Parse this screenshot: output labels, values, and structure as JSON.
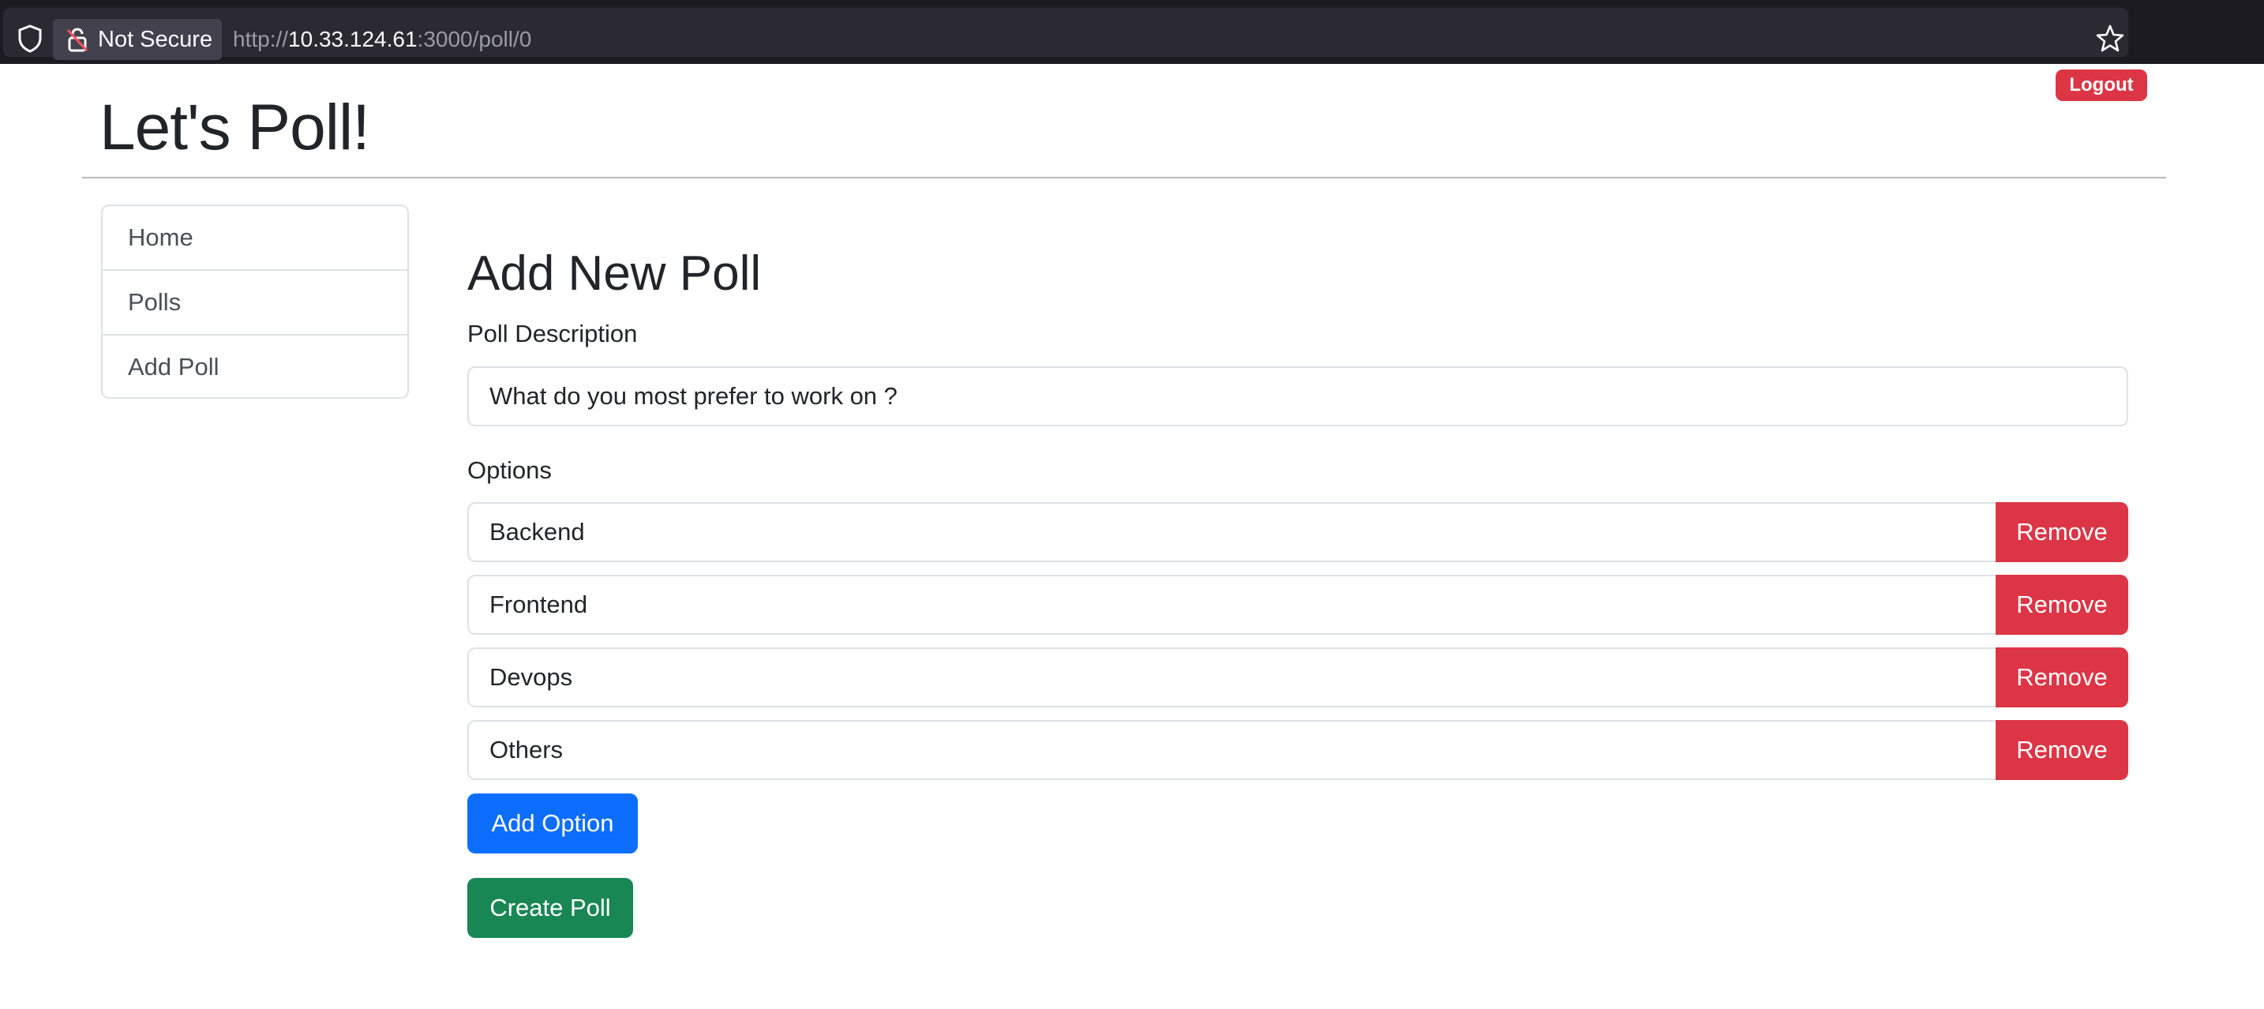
{
  "browser": {
    "security_label": "Not Secure",
    "url_scheme": "http://",
    "url_host": "10.33.124.61",
    "url_rest": ":3000/poll/0",
    "icons": [
      "shield-icon",
      "broken-lock-icon",
      "bookmark-star-icon"
    ]
  },
  "header": {
    "title": "Let's Poll!",
    "logout_label": "Logout"
  },
  "sidebar": {
    "items": [
      {
        "label": "Home"
      },
      {
        "label": "Polls"
      },
      {
        "label": "Add Poll"
      }
    ]
  },
  "form": {
    "title": "Add New Poll",
    "description_label": "Poll Description",
    "description_value": "What do you most prefer to work on ?",
    "options_label": "Options",
    "options": [
      {
        "value": "Backend",
        "remove_label": "Remove"
      },
      {
        "value": "Frontend",
        "remove_label": "Remove"
      },
      {
        "value": "Devops",
        "remove_label": "Remove"
      },
      {
        "value": "Others",
        "remove_label": "Remove"
      }
    ],
    "add_option_label": "Add Option",
    "create_poll_label": "Create Poll"
  },
  "colors": {
    "danger": "#dc3545",
    "primary": "#0d6efd",
    "success": "#198754",
    "chrome_bg": "#1c1b22"
  }
}
